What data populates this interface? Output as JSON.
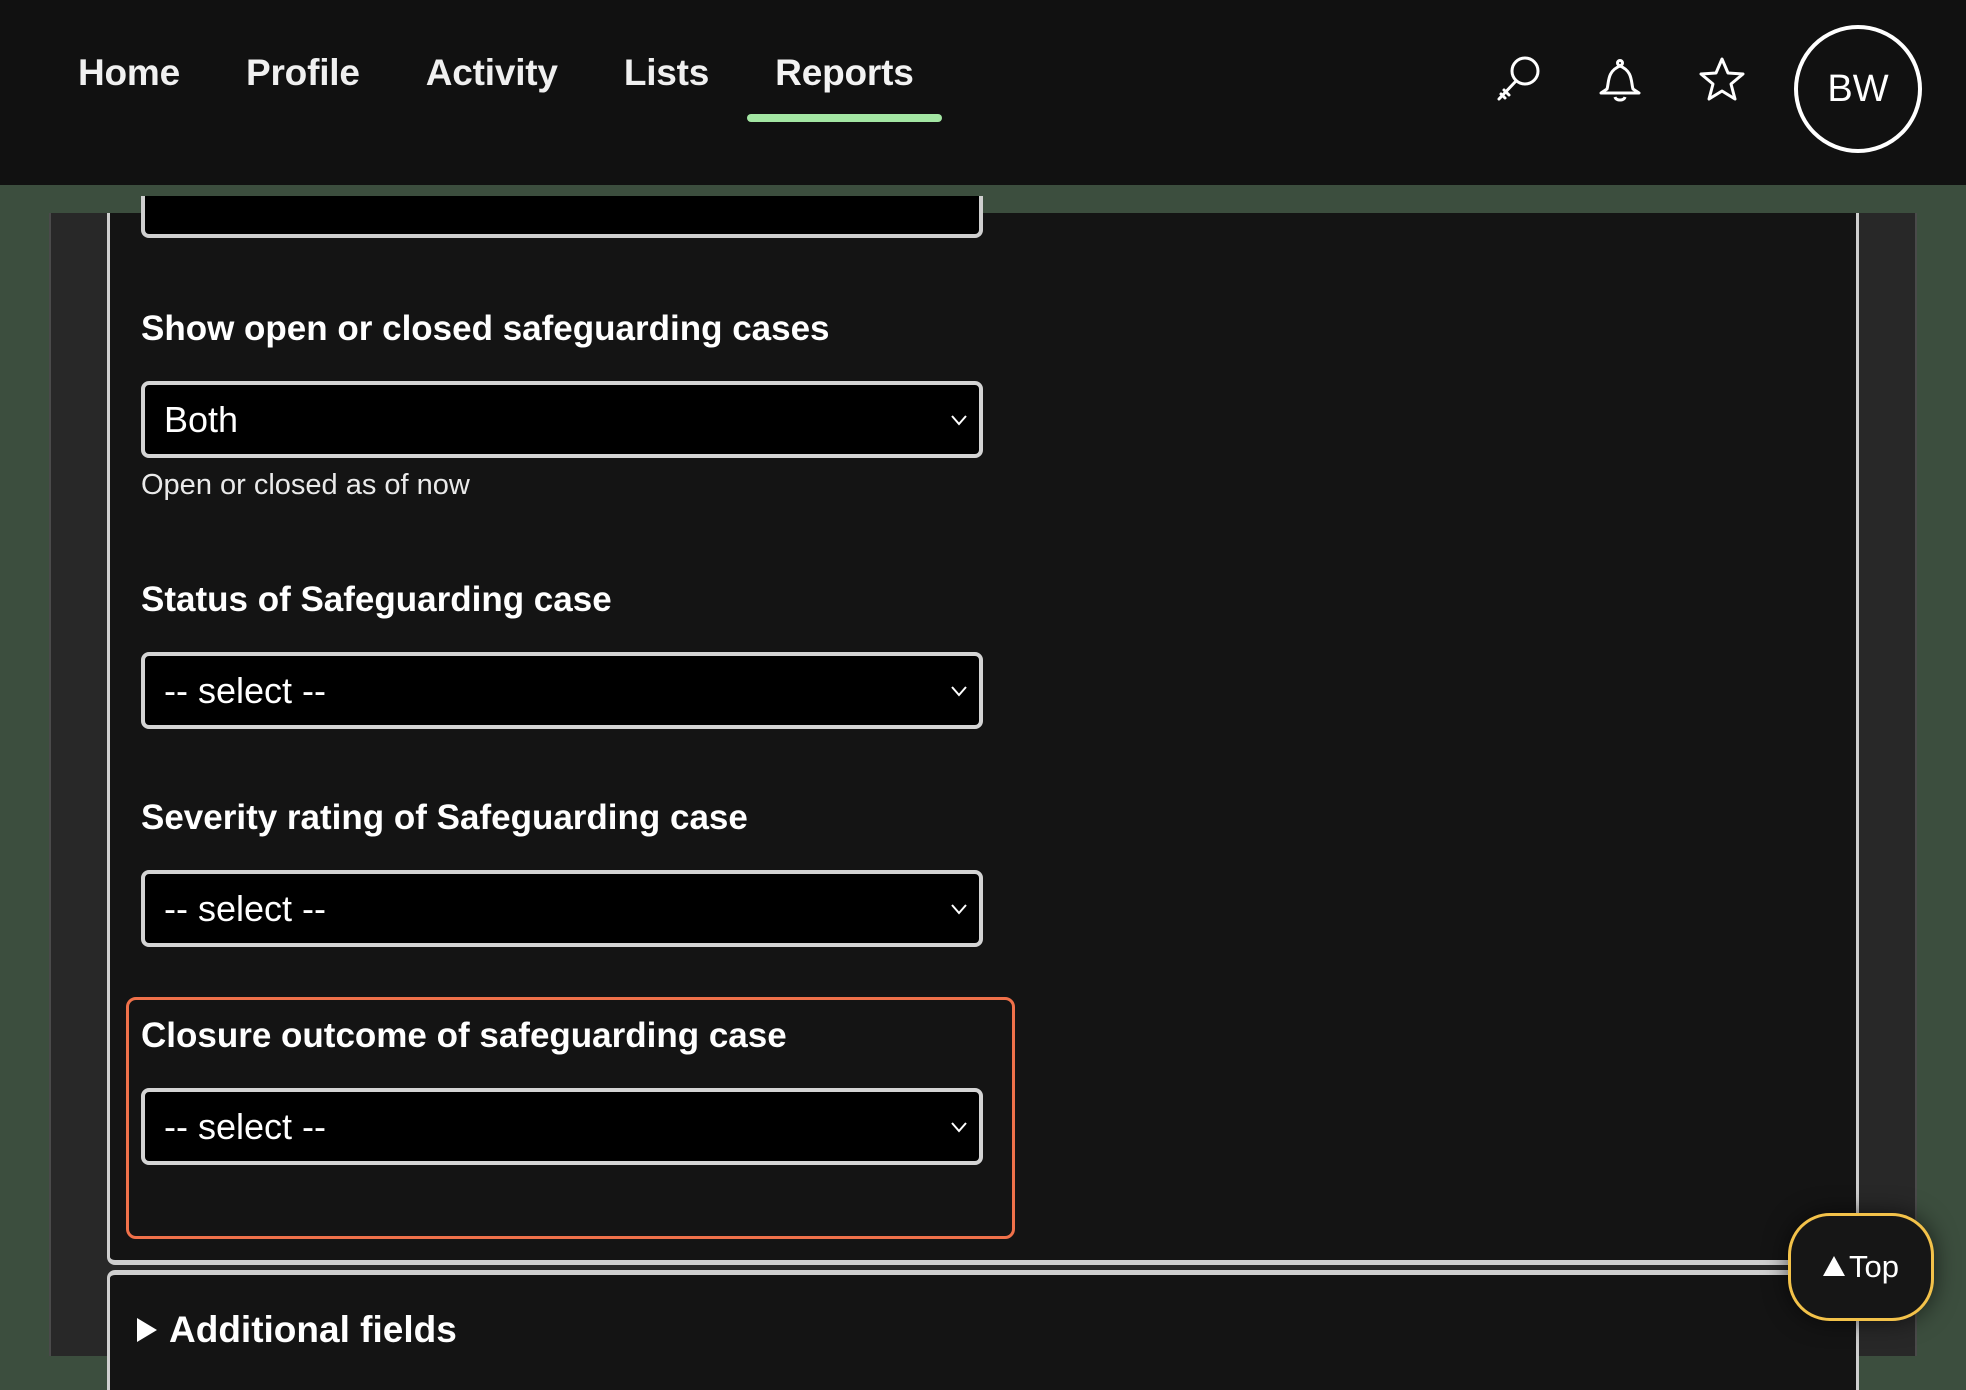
{
  "nav": {
    "items": [
      {
        "label": "Home"
      },
      {
        "label": "Profile"
      },
      {
        "label": "Activity"
      },
      {
        "label": "Lists"
      },
      {
        "label": "Reports",
        "active": true
      }
    ],
    "icons": [
      "search-icon",
      "bell-icon",
      "star-icon"
    ],
    "avatar_initials": "BW",
    "accent_color": "#a3e6a3"
  },
  "form": {
    "open_closed": {
      "label": "Show open or closed safeguarding cases",
      "value": "Both",
      "hint": "Open or closed as of now"
    },
    "status": {
      "label": "Status of Safeguarding case",
      "value": "-- select --"
    },
    "severity": {
      "label": "Severity rating of Safeguarding case",
      "value": "-- select --"
    },
    "closure": {
      "label": "Closure outcome of safeguarding case",
      "value": "-- select --",
      "highlight_color": "#f0714a"
    }
  },
  "additional": {
    "label": "Additional fields"
  },
  "top_button": {
    "label": "Top"
  }
}
